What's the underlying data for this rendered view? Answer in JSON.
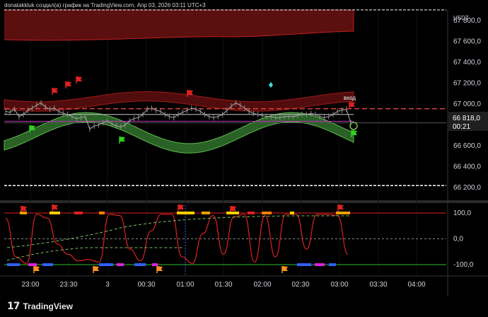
{
  "header": {
    "caption": "donatakkluk создал(а) график на TradingView.com, Апр 03, 2026 03:11 UTC+3"
  },
  "currency": "USDT",
  "price_box": {
    "value": "66 818,0",
    "countdown": "00:21"
  },
  "annotation": "вход",
  "brand": {
    "name": "TradingView",
    "mark": "17"
  },
  "colors": {
    "background": "#000000",
    "upper_band": "#6b1212",
    "lower_band": "#2f6b2a",
    "price_line": "#b0b0b0",
    "red_dashed": "#e04040",
    "osc_line": "#e02020",
    "osc_dashed": "#7ec15a",
    "flag_red": "#e02020",
    "flag_green": "#30d020"
  },
  "chart_data": [
    {
      "type": "line",
      "ylim": [
        66100,
        67900
      ],
      "y_ticks": [
        "67 800,0",
        "67 600,0",
        "67 400,0",
        "67 200,0",
        "67 000,0",
        "66 800,0",
        "66 600,0",
        "66 400,0",
        "66 200,0"
      ],
      "y_values": [
        67800,
        67600,
        67400,
        67200,
        67000,
        66800,
        66600,
        66400,
        66200
      ],
      "x_ticks": [
        "23:00",
        "23:30",
        "3",
        "00:30",
        "01:00",
        "01:30",
        "02:00",
        "02:30",
        "03:00",
        "03:30",
        "04:00"
      ],
      "x_tick_pos": [
        43,
        97,
        152,
        207,
        262,
        316,
        371,
        425,
        480,
        535,
        589
      ],
      "series": [
        {
          "values": [
            66930,
            66920,
            66950,
            66880,
            66900,
            66940,
            66960,
            66990,
            67010,
            66970,
            66950,
            66960,
            66930,
            66910,
            66900,
            66880,
            66860,
            66870,
            66880,
            66760,
            66790,
            66800,
            66820,
            66840,
            66810,
            66790,
            66780,
            66800,
            66840,
            66860,
            66870,
            66900,
            66950,
            66960,
            66940,
            66930,
            66900,
            66880,
            66870,
            66900,
            66920,
            66940,
            66960,
            66950,
            66930,
            66900,
            66880,
            66870,
            66880,
            66900,
            66940,
            66980,
            67010,
            66990,
            66960,
            66930,
            66910,
            66900,
            66890,
            66880,
            66880,
            66870,
            66870,
            66880,
            66880,
            66880,
            66890,
            66900,
            66900,
            66910,
            66900,
            66880,
            66870,
            66880,
            66900,
            66930,
            66940,
            66950,
            66820
          ]
        }
      ],
      "reference_lines": {
        "red_dashed": 66955,
        "gray": 66820,
        "white_top": 67900,
        "white_bottom": 66220
      },
      "annotations": [
        "вход"
      ]
    },
    {
      "type": "line",
      "ylim": [
        -130,
        130
      ],
      "y_ticks": [
        "100,0",
        "0,0",
        "-100,0"
      ],
      "y_values": [
        100,
        0,
        -100
      ],
      "series": [
        {
          "values": [
            80,
            -70,
            -95,
            95,
            80,
            -20,
            -60,
            -85,
            -80,
            -90,
            95,
            90,
            -40,
            -85,
            30,
            95,
            95,
            -70,
            -95,
            20,
            90,
            -60,
            85,
            95,
            -90,
            90,
            -70,
            95,
            95,
            -40,
            95,
            95,
            90,
            -60
          ]
        }
      ],
      "reference_lines": {
        "upper": 100,
        "zero": 0,
        "lower": -100
      }
    }
  ]
}
